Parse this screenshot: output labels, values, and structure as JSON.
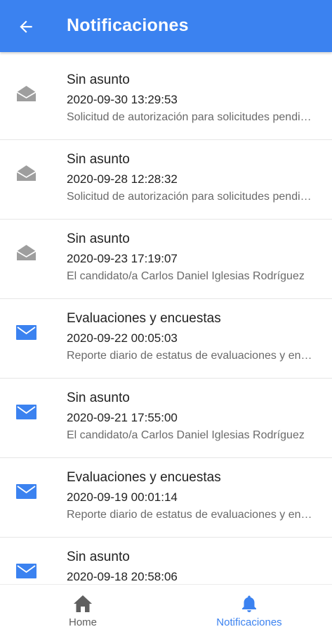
{
  "header": {
    "title": "Notificaciones",
    "back_icon": "arrow-back-icon",
    "background": "#3b82f0"
  },
  "notifications": [
    {
      "subject": "Sin asunto",
      "date": "2020-09-30 13:29:53",
      "preview": "Solicitud de autorización para solicitudes pendientes",
      "read": true
    },
    {
      "subject": "Sin asunto",
      "date": "2020-09-28 12:28:32",
      "preview": "Solicitud de autorización para solicitudes pendientes",
      "read": true
    },
    {
      "subject": "Sin asunto",
      "date": "2020-09-23 17:19:07",
      "preview": "El candidato/a Carlos Daniel Iglesias Rodríguez",
      "read": true
    },
    {
      "subject": "Evaluaciones y encuestas",
      "date": "2020-09-22 00:05:03",
      "preview": "Reporte diario de estatus de evaluaciones y encuestas",
      "read": false
    },
    {
      "subject": "Sin asunto",
      "date": "2020-09-21 17:55:00",
      "preview": "El candidato/a Carlos Daniel Iglesias Rodríguez",
      "read": false
    },
    {
      "subject": "Evaluaciones y encuestas",
      "date": "2020-09-19 00:01:14",
      "preview": "Reporte diario de estatus de evaluaciones y encuestas",
      "read": false
    },
    {
      "subject": "Sin asunto",
      "date": "2020-09-18 20:58:06",
      "preview": "",
      "read": false
    }
  ],
  "icons": {
    "read": "envelope-open-icon",
    "unread": "envelope-closed-icon",
    "read_color": "#9e9e9e",
    "unread_color": "#3b82f0"
  },
  "bottom_nav": {
    "home_label": "Home",
    "home_icon": "home-icon",
    "notifications_label": "Notificaciones",
    "notifications_icon": "bell-icon",
    "active": "Notificaciones",
    "active_color": "#3b82f0",
    "inactive_color": "#5f5f5f"
  }
}
